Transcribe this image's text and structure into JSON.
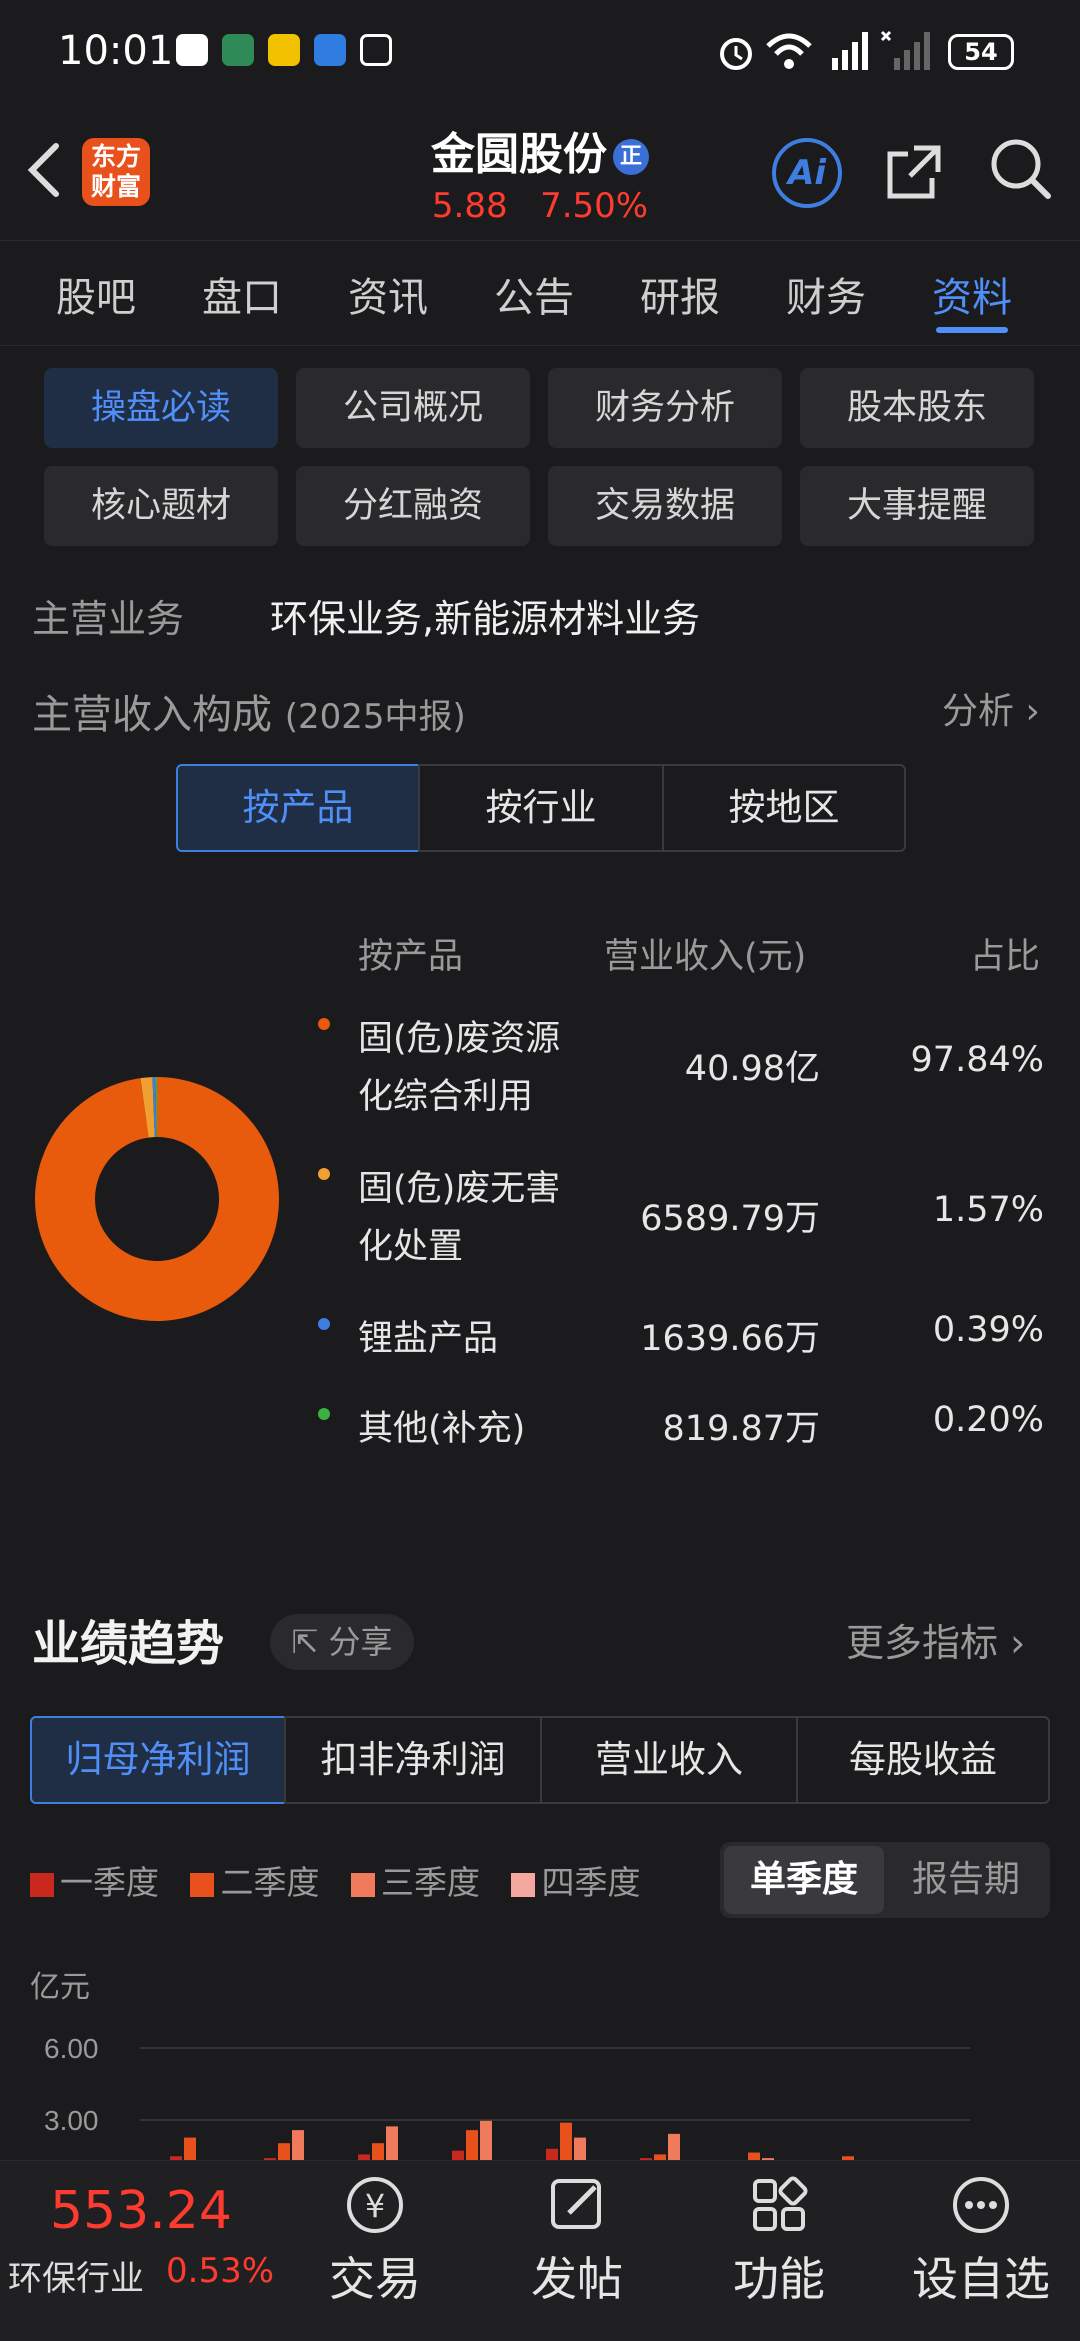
{
  "status": {
    "time": "10:01",
    "battery": "54"
  },
  "header": {
    "logo": "东方财富",
    "title": "金圆股份",
    "badge": "正",
    "price": "5.88",
    "change": "7.50%"
  },
  "tabs": [
    "股吧",
    "盘口",
    "资讯",
    "公告",
    "研报",
    "财务",
    "资料"
  ],
  "subnav": [
    "操盘必读",
    "公司概况",
    "财务分析",
    "股本股东",
    "核心题材",
    "分红融资",
    "交易数据",
    "大事提醒"
  ],
  "main_business": {
    "label": "主营业务",
    "value": "环保业务,新能源材料业务"
  },
  "revenue": {
    "title": "主营收入构成",
    "period": "(2025中报)",
    "analyze": "分析",
    "segments": [
      "按产品",
      "按行业",
      "按地区"
    ],
    "headers": [
      "按产品",
      "营业收入(元)",
      "占比"
    ],
    "rows": [
      {
        "name_1": "固(危)废资源",
        "name_2": "化综合利用",
        "amount": "40.98亿",
        "ratio": "97.84%",
        "color": "#e85a0c",
        "share": 97.84
      },
      {
        "name_1": "固(危)废无害",
        "name_2": "化处置",
        "amount": "6589.79万",
        "ratio": "1.57%",
        "color": "#f0a030",
        "share": 1.57
      },
      {
        "name_1": "锂盐产品",
        "name_2": "",
        "amount": "1639.66万",
        "ratio": "0.39%",
        "color": "#3e7ee0",
        "share": 0.39
      },
      {
        "name_1": "其他(补充)",
        "name_2": "",
        "amount": "819.87万",
        "ratio": "0.20%",
        "color": "#3cb040",
        "share": 0.2
      }
    ]
  },
  "trend": {
    "title": "业绩趋势",
    "share": "分享",
    "more": "更多指标",
    "tabs": [
      "归母净利润",
      "扣非净利润",
      "营业收入",
      "每股收益"
    ],
    "legend": [
      {
        "label": "一季度",
        "color": "#c8281e"
      },
      {
        "label": "二季度",
        "color": "#e8501c"
      },
      {
        "label": "三季度",
        "color": "#f07a5c"
      },
      {
        "label": "四季度",
        "color": "#f5a8a0"
      }
    ],
    "period_toggle": [
      "单季度",
      "报告期"
    ],
    "unit": "亿元",
    "yticks": [
      "6.00",
      "3.00"
    ]
  },
  "chart_data": {
    "type": "bar",
    "ylabel": "亿元",
    "ylim": [
      0,
      6
    ],
    "series": [
      {
        "name": "一季度",
        "values": [
          0.2,
          0.1,
          0.3,
          0.5,
          0.6,
          0.1,
          0.0,
          0.0
        ]
      },
      {
        "name": "二季度",
        "values": [
          1.2,
          0.9,
          0.9,
          1.6,
          2.0,
          0.3,
          0.4,
          0.2
        ]
      },
      {
        "name": "三季度",
        "values": [
          0.0,
          1.6,
          1.8,
          2.1,
          1.2,
          1.4,
          0.1,
          0.0
        ]
      },
      {
        "name": "四季度",
        "values": [
          0.0,
          0.0,
          0.0,
          0.0,
          0.0,
          0.0,
          0.0,
          0.0
        ]
      }
    ]
  },
  "bottom": {
    "index_value": "553.24",
    "industry": "环保行业",
    "industry_change": "0.53%",
    "items": [
      "交易",
      "发帖",
      "功能",
      "设自选"
    ]
  }
}
